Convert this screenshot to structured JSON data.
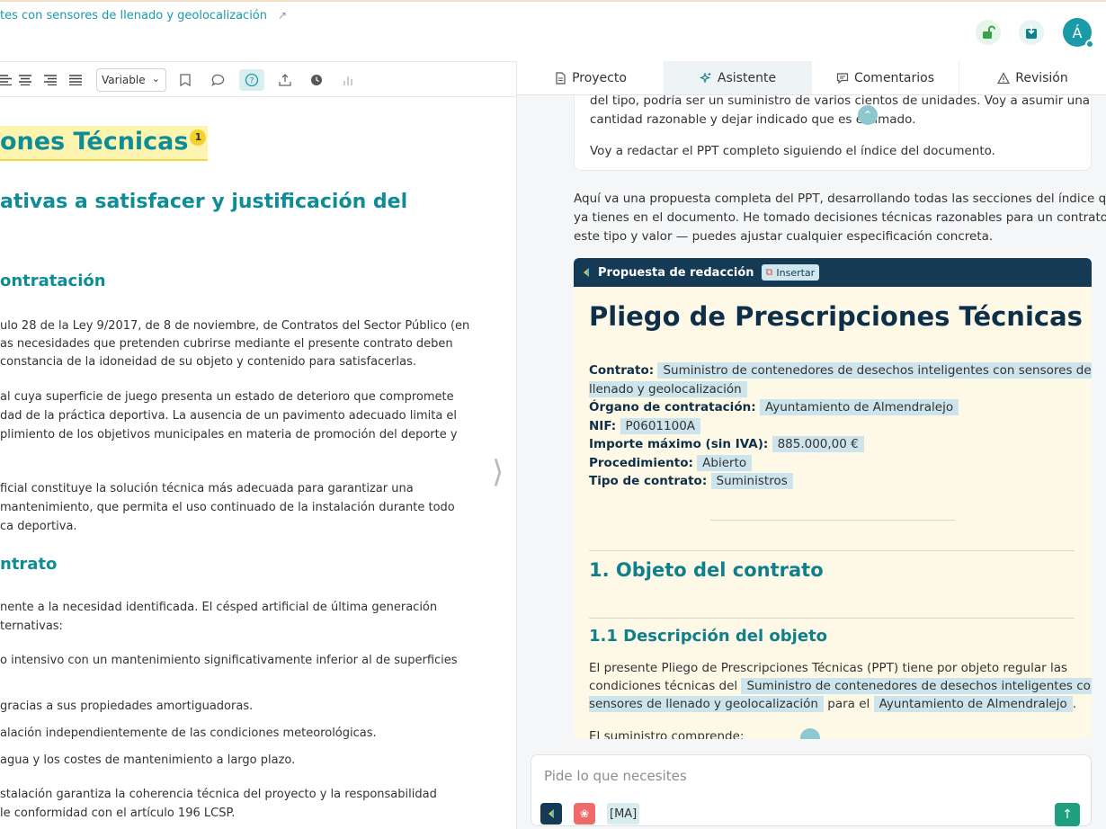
{
  "header": {
    "doc_link": "tes con sensores de llenado y geolocalización",
    "avatar_initial": "Á"
  },
  "toolbar": {
    "style_select": "Variable"
  },
  "document": {
    "title": "ones Técnicas",
    "title_badge": "1",
    "h2": "ativas a satisfacer y justificación del",
    "h3_contratacion": "ontratación",
    "p1": [
      "ulo 28 de la Ley 9/2017, de 8 de noviembre, de Contratos del Sector Público (en",
      "as necesidades que pretenden cubrirse mediante el presente contrato deben",
      "constancia de la idoneidad de su objeto y contenido para satisfacerlas."
    ],
    "p2": [
      "al cuya superficie de juego presenta un estado de deterioro que compromete",
      "dad de la práctica deportiva. La ausencia de un pavimento adecuado limita el",
      "plimiento de los objetivos municipales en materia de promoción del deporte y"
    ],
    "p3": [
      "ficial constituye la solución técnica más adecuada para garantizar una",
      " mantenimiento, que permita el uso continuado de la instalación durante todo",
      "ca deportiva."
    ],
    "h3_contrato": "ntrato",
    "p4": [
      "nente a la necesidad identificada. El césped artificial de última generación",
      "ternativas:"
    ],
    "bullets": [
      "o intensivo con un mantenimiento significativamente inferior al de superficies",
      "gracias a sus propiedades amortiguadoras.",
      "alación independientemente de las condiciones meteorológicas.",
      "agua y los costes de mantenimiento a largo plazo."
    ],
    "p5": [
      "stalación garantiza la coherencia técnica del proyecto y la responsabilidad",
      "le conformidad con el artículo 196 LCSP."
    ]
  },
  "tabs": [
    {
      "label": "Proyecto",
      "icon": "file-icon"
    },
    {
      "label": "Asistente",
      "icon": "sparkle-icon"
    },
    {
      "label": "Comentarios",
      "icon": "comment-icon"
    },
    {
      "label": "Revisión",
      "icon": "warning-icon"
    }
  ],
  "chat": {
    "msg_lines": [
      "del tipo, podría ser un suministro de varios cientos de unidades. Voy a asumir una",
      "cantidad razonable y dejar indicado que es estimado.",
      "Voy a redactar el PPT completo siguiendo el índice del documento."
    ],
    "intro": [
      "Aquí va una propuesta completa del PPT, desarrollando todas las secciones del índice que",
      "ya tienes en el documento. He tomado decisiones técnicas razonables para un contrato de",
      "este tipo y valor — puedes ajustar cualquier especificación concreta."
    ]
  },
  "proposal": {
    "header_label": "Propuesta de redacción",
    "insert_label": "Insertar",
    "title": "Pliego de Prescripciones Técnicas",
    "contrato_label": "Contrato:",
    "contrato_value_1": "Suministro de contenedores de desechos inteligentes con sensores de",
    "contrato_value_2": "llenado y geolocalización",
    "organo_label": "Órgano de contratación:",
    "organo_value": "Ayuntamiento de Almendralejo",
    "nif_label": "NIF:",
    "nif_value": "P0601100A",
    "importe_label": "Importe máximo (sin IVA):",
    "importe_value": "885.000,00 €",
    "procedimiento_label": "Procedimiento:",
    "procedimiento_value": "Abierto",
    "tipo_label": "Tipo de contrato:",
    "tipo_value": "Suministros",
    "section1": "1. Objeto del contrato",
    "section11": "1.1 Descripción del objeto",
    "desc_line1": "El presente Pliego de Prescripciones Técnicas (PPT) tiene por objeto regular las",
    "desc_line2_pre": "condiciones técnicas del",
    "desc_line2_hl": "Suministro de contenedores de desechos inteligentes con",
    "desc_line3_hl": "sensores de llenado y geolocalización",
    "desc_line3_mid": "para el",
    "desc_line3_hl2": "Ayuntamiento de Almendralejo",
    "desc_line3_end": ".",
    "desc_line4": "El suministro comprende:"
  },
  "composer": {
    "placeholder": "Pide lo que necesites",
    "chip": "[MA]"
  },
  "colors": {
    "accent": "#0f8d96",
    "proposal_header": "#153a56",
    "highlight": "#cde4ec",
    "send": "#1d9f80"
  }
}
